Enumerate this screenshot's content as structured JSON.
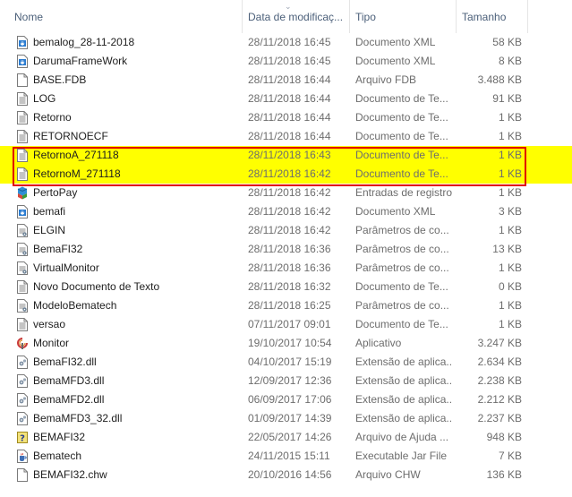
{
  "columns": {
    "name": "Nome",
    "date": "Data de modificaç...",
    "type": "Tipo",
    "size": "Tamanho"
  },
  "highlight_color": "#ffff00",
  "highlight_border_color": "#e10000",
  "files": [
    {
      "name": "bemalog_28-11-2018",
      "date": "28/11/2018 16:45",
      "type": "Documento XML",
      "size": "58 KB",
      "icon": "xml-file-icon",
      "highlighted": false
    },
    {
      "name": "DarumaFrameWork",
      "date": "28/11/2018 16:45",
      "type": "Documento XML",
      "size": "8 KB",
      "icon": "xml-file-icon",
      "highlighted": false
    },
    {
      "name": "BASE.FDB",
      "date": "28/11/2018 16:44",
      "type": "Arquivo FDB",
      "size": "3.488 KB",
      "icon": "blank-file-icon",
      "highlighted": false
    },
    {
      "name": "LOG",
      "date": "28/11/2018 16:44",
      "type": "Documento de Te...",
      "size": "91 KB",
      "icon": "text-file-icon",
      "highlighted": false
    },
    {
      "name": "Retorno",
      "date": "28/11/2018 16:44",
      "type": "Documento de Te...",
      "size": "1 KB",
      "icon": "text-file-icon",
      "highlighted": false
    },
    {
      "name": "RETORNOECF",
      "date": "28/11/2018 16:44",
      "type": "Documento de Te...",
      "size": "1 KB",
      "icon": "text-file-icon",
      "highlighted": false
    },
    {
      "name": "RetornoA_271118",
      "date": "28/11/2018 16:43",
      "type": "Documento de Te...",
      "size": "1 KB",
      "icon": "text-file-icon",
      "highlighted": true
    },
    {
      "name": "RetornoM_271118",
      "date": "28/11/2018 16:42",
      "type": "Documento de Te...",
      "size": "1 KB",
      "icon": "text-file-icon",
      "highlighted": true
    },
    {
      "name": "PertoPay",
      "date": "28/11/2018 16:42",
      "type": "Entradas de registro",
      "size": "1 KB",
      "icon": "registry-file-icon",
      "highlighted": false
    },
    {
      "name": "bemafi",
      "date": "28/11/2018 16:42",
      "type": "Documento XML",
      "size": "3 KB",
      "icon": "xml-file-icon",
      "highlighted": false
    },
    {
      "name": "ELGIN",
      "date": "28/11/2018 16:42",
      "type": "Parâmetros de co...",
      "size": "1 KB",
      "icon": "config-file-icon",
      "highlighted": false
    },
    {
      "name": "BemaFI32",
      "date": "28/11/2018 16:36",
      "type": "Parâmetros de co...",
      "size": "13 KB",
      "icon": "config-file-icon",
      "highlighted": false
    },
    {
      "name": "VirtualMonitor",
      "date": "28/11/2018 16:36",
      "type": "Parâmetros de co...",
      "size": "1 KB",
      "icon": "config-file-icon",
      "highlighted": false
    },
    {
      "name": "Novo Documento de Texto",
      "date": "28/11/2018 16:32",
      "type": "Documento de Te...",
      "size": "0 KB",
      "icon": "text-file-icon",
      "highlighted": false
    },
    {
      "name": "ModeloBematech",
      "date": "28/11/2018 16:25",
      "type": "Parâmetros de co...",
      "size": "1 KB",
      "icon": "config-file-icon",
      "highlighted": false
    },
    {
      "name": "versao",
      "date": "07/11/2017 09:01",
      "type": "Documento de Te...",
      "size": "1 KB",
      "icon": "text-file-icon",
      "highlighted": false
    },
    {
      "name": "Monitor",
      "date": "19/10/2017 10:54",
      "type": "Aplicativo",
      "size": "3.247 KB",
      "icon": "application-icon",
      "highlighted": false
    },
    {
      "name": "BemaFI32.dll",
      "date": "04/10/2017 15:19",
      "type": "Extensão de aplica...",
      "size": "2.634 KB",
      "icon": "dll-file-icon",
      "highlighted": false
    },
    {
      "name": "BemaMFD3.dll",
      "date": "12/09/2017 12:36",
      "type": "Extensão de aplica...",
      "size": "2.238 KB",
      "icon": "dll-file-icon",
      "highlighted": false
    },
    {
      "name": "BemaMFD2.dll",
      "date": "06/09/2017 17:06",
      "type": "Extensão de aplica...",
      "size": "2.212 KB",
      "icon": "dll-file-icon",
      "highlighted": false
    },
    {
      "name": "BemaMFD3_32.dll",
      "date": "01/09/2017 14:39",
      "type": "Extensão de aplica...",
      "size": "2.237 KB",
      "icon": "dll-file-icon",
      "highlighted": false
    },
    {
      "name": "BEMAFI32",
      "date": "22/05/2017 14:26",
      "type": "Arquivo de Ajuda ...",
      "size": "948 KB",
      "icon": "help-file-icon",
      "highlighted": false
    },
    {
      "name": "Bematech",
      "date": "24/11/2015 15:11",
      "type": "Executable Jar File",
      "size": "7 KB",
      "icon": "jar-file-icon",
      "highlighted": false
    },
    {
      "name": "BEMAFI32.chw",
      "date": "20/10/2016 14:56",
      "type": "Arquivo CHW",
      "size": "136 KB",
      "icon": "blank-file-icon",
      "highlighted": false
    }
  ]
}
